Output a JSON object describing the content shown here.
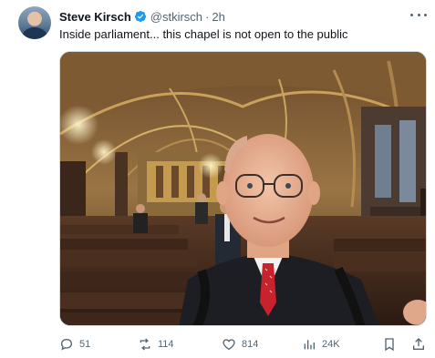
{
  "author": {
    "display_name": "Steve Kirsch",
    "handle": "@stkirsch",
    "dot": "·",
    "time": "2h"
  },
  "tweet_text": "Inside parliament... this chapel is not open to the public",
  "media": {
    "alt": "photo"
  },
  "actions": {
    "reply_count": "51",
    "repost_count": "114",
    "like_count": "814",
    "views_count": "24K"
  },
  "colors": {
    "verified_blue": "#1d9bf0",
    "muted_text": "#536471",
    "tie_red": "#c8232c"
  },
  "icons": [
    "verified-badge-icon",
    "more-icon",
    "reply-icon",
    "repost-icon",
    "like-icon",
    "views-icon",
    "bookmark-icon",
    "share-icon"
  ]
}
